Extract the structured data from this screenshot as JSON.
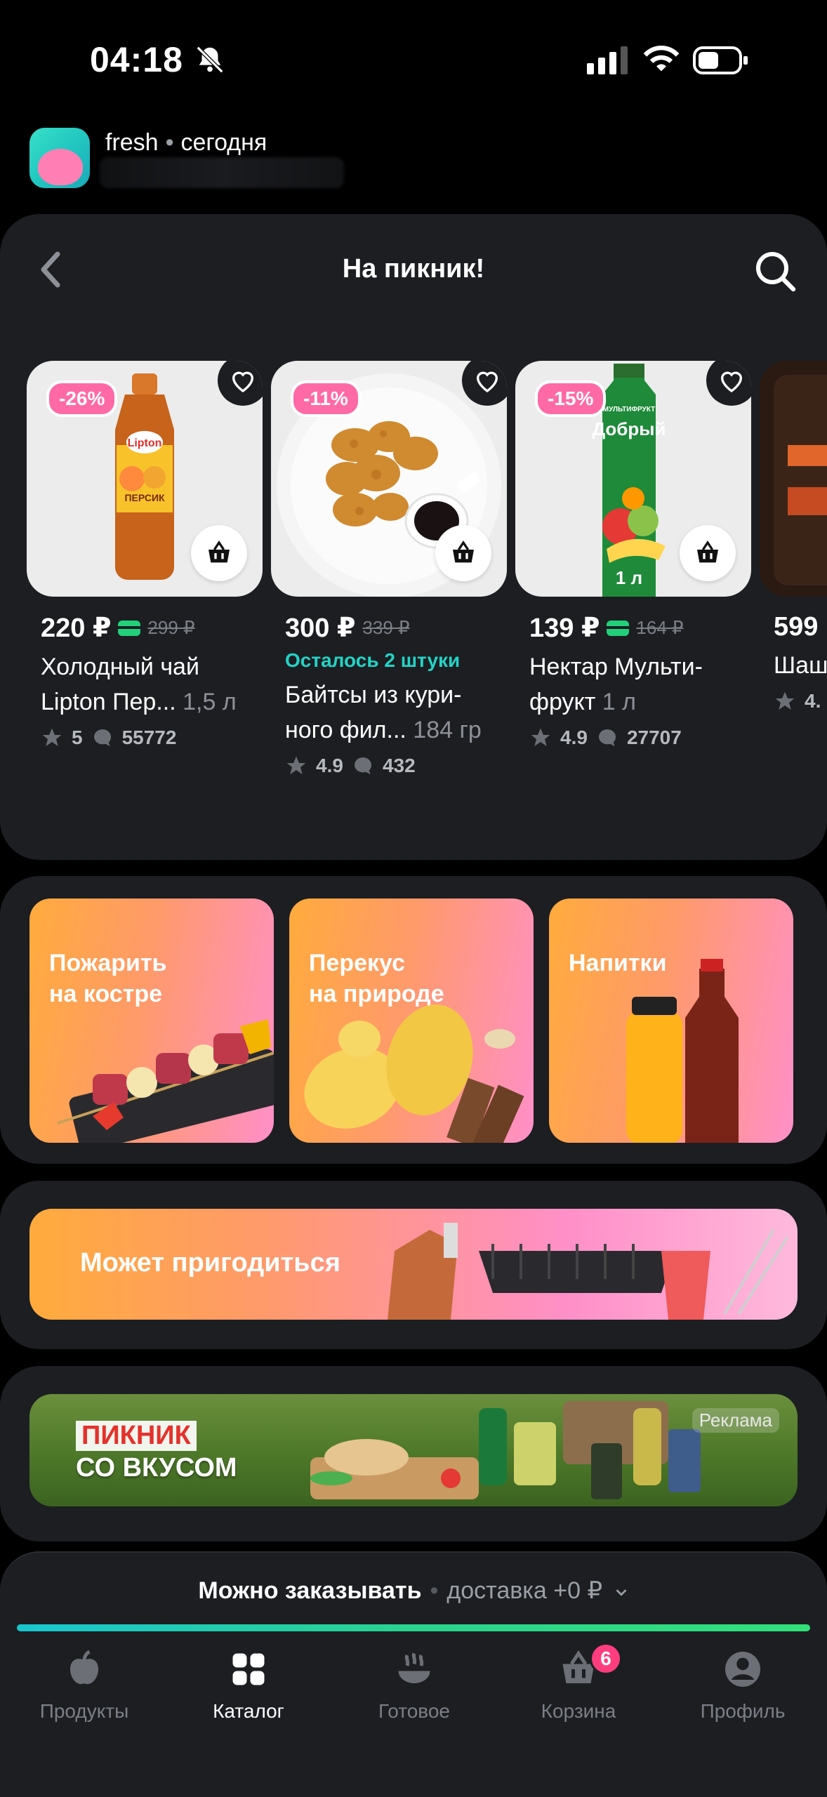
{
  "status_bar": {
    "time": "04:18"
  },
  "app_header": {
    "name": "fresh",
    "when": "сегодня"
  },
  "nav": {
    "title": "На пикник!"
  },
  "products": [
    {
      "discount": "-26%",
      "price": "220 ₽",
      "old_price": "299 ₽",
      "has_card_badge": true,
      "stock_note": "",
      "name": "Холодный чай Lipton Пер...",
      "weight": "1,5 л",
      "rating": "5",
      "reviews": "55772"
    },
    {
      "discount": "-11%",
      "price": "300 ₽",
      "old_price": "339 ₽",
      "has_card_badge": false,
      "stock_note": "Осталось 2 штуки",
      "name": "Байтсы из кури-ного фил...",
      "weight": "184 гр",
      "rating": "4.9",
      "reviews": "432"
    },
    {
      "discount": "-15%",
      "price": "139 ₽",
      "old_price": "164 ₽",
      "has_card_badge": true,
      "stock_note": "",
      "name": "Нектар Мульти-фрукт",
      "weight": "1 л",
      "rating": "4.9",
      "reviews": "27707"
    },
    {
      "discount": "",
      "price": "599",
      "old_price": "",
      "has_card_badge": false,
      "stock_note": "",
      "name": "Шаш... цы С...",
      "weight": "",
      "rating": "4.",
      "reviews": ""
    }
  ],
  "product_image_labels": {
    "tea_brand": "Lipton",
    "tea_flavor": "ПЕРСИК",
    "juice_brand": "МУЛЬТИФРУКТ",
    "juice_name": "Добрый",
    "juice_volume": "1 л"
  },
  "categories": [
    {
      "label_l1": "Пожарить",
      "label_l2": "на костре"
    },
    {
      "label_l1": "Перекус",
      "label_l2": "на природе"
    },
    {
      "label_l1": "Напитки",
      "label_l2": ""
    }
  ],
  "banner_useful": {
    "label": "Может пригодиться"
  },
  "banner_ad": {
    "line1": "ПИКНИК",
    "line2": "СО ВКУСОМ",
    "ad_label": "Реклама"
  },
  "order_bar": {
    "status": "Можно заказывать",
    "delivery": "доставка +0 ₽",
    "progress": 1.0
  },
  "tabs": [
    {
      "label": "Продукты",
      "icon": "apple-icon",
      "active": false
    },
    {
      "label": "Каталог",
      "icon": "grid-icon",
      "active": true
    },
    {
      "label": "Готовое",
      "icon": "hot-dish-icon",
      "active": false
    },
    {
      "label": "Корзина",
      "icon": "basket-icon",
      "active": false,
      "badge": "6"
    },
    {
      "label": "Профиль",
      "icon": "profile-icon",
      "active": false
    }
  ],
  "colors": {
    "accent_teal": "#23d3c6",
    "discount_pink": "#ff6aa6",
    "badge_pink": "#ff3d7f",
    "card_green": "#22d07a"
  }
}
